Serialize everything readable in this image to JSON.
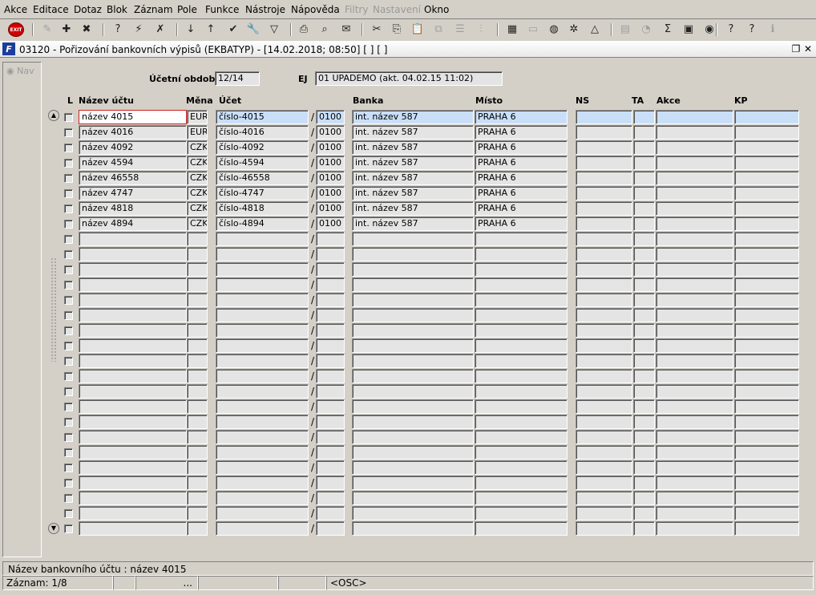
{
  "menu": [
    {
      "label": "Akce",
      "disabled": false
    },
    {
      "label": "Editace",
      "disabled": false
    },
    {
      "label": "Dotaz",
      "disabled": false
    },
    {
      "label": "Blok",
      "disabled": false
    },
    {
      "label": "Záznam",
      "disabled": false
    },
    {
      "label": "Pole",
      "disabled": false
    },
    {
      "label": "Funkce",
      "disabled": false
    },
    {
      "label": "Nástroje",
      "disabled": false
    },
    {
      "label": "Nápověda",
      "disabled": false
    },
    {
      "label": "Filtry",
      "disabled": true
    },
    {
      "label": "Nastavení",
      "disabled": true
    },
    {
      "label": "Okno",
      "disabled": false
    }
  ],
  "toolbar": {
    "exit_label": "EXIT",
    "icons": [
      "edit-icon",
      "insert-record-icon",
      "delete-record-icon",
      "query-enter-icon",
      "query-execute-icon",
      "query-cancel-icon",
      "sort-asc-icon",
      "sort-desc-icon",
      "commit-check-icon",
      "tools-wrench-icon",
      "filter-icon",
      "print-icon",
      "print-preview-icon",
      "mail-icon",
      "cut-icon",
      "copy-icon",
      "paste-icon",
      "duplicate-icon",
      "list-icon",
      "tree-icon",
      "calculator-icon",
      "document-icon",
      "globe-icon",
      "settings-wheel-icon",
      "triangle-icon",
      "chart-icon",
      "chart-pie-icon",
      "sum-icon",
      "excel-icon",
      "internet-icon",
      "help-icon",
      "context-help-icon",
      "info-icon"
    ]
  },
  "window": {
    "title": "03120 - Pořizování bankovních výpisů (EKBATYP) - [14.02.2018; 08:50]  [ ]  [ ]",
    "app_icon": "F"
  },
  "nav_label": "Nav",
  "header_fields": {
    "period_label": "Účetní období",
    "period_value": "12/14",
    "ej_label": "EJ",
    "ej_value": "01 UPADEMO (akt. 04.02.15 11:02)"
  },
  "columns": {
    "l": "L",
    "account_name": "Název účtu",
    "currency": "Měna",
    "account": "Účet",
    "bank": "Banka",
    "place": "Místo",
    "ns": "NS",
    "ta": "TA",
    "action": "Akce",
    "kp": "KP"
  },
  "rows": [
    {
      "name": "název 4015",
      "currency": "EUR",
      "account": "číslo-4015",
      "code": "0100",
      "bank": "int. název 587",
      "place": "PRAHA 6"
    },
    {
      "name": "název 4016",
      "currency": "EUR",
      "account": "číslo-4016",
      "code": "0100",
      "bank": "int. název 587",
      "place": "PRAHA 6"
    },
    {
      "name": "název 4092",
      "currency": "CZK",
      "account": "číslo-4092",
      "code": "0100",
      "bank": "int. název 587",
      "place": "PRAHA 6"
    },
    {
      "name": "název 4594",
      "currency": "CZK",
      "account": "číslo-4594",
      "code": "0100",
      "bank": "int. název 587",
      "place": "PRAHA 6"
    },
    {
      "name": "název 46558",
      "currency": "CZK",
      "account": "číslo-46558",
      "code": "0100",
      "bank": "int. název 587",
      "place": "PRAHA 6"
    },
    {
      "name": "název 4747",
      "currency": "CZK",
      "account": "číslo-4747",
      "code": "0100",
      "bank": "int. název 587",
      "place": "PRAHA 6"
    },
    {
      "name": "název 4818",
      "currency": "CZK",
      "account": "číslo-4818",
      "code": "0100",
      "bank": "int. název 587",
      "place": "PRAHA 6"
    },
    {
      "name": "název 4894",
      "currency": "CZK",
      "account": "číslo-4894",
      "code": "0100",
      "bank": "int. název 587",
      "place": "PRAHA 6"
    }
  ],
  "separator": "/",
  "status": {
    "hint": "Název bankovního účtu : název 4015",
    "record": "Záznam: 1/8",
    "seg_dots": "...",
    "mode": "<OSC>"
  }
}
